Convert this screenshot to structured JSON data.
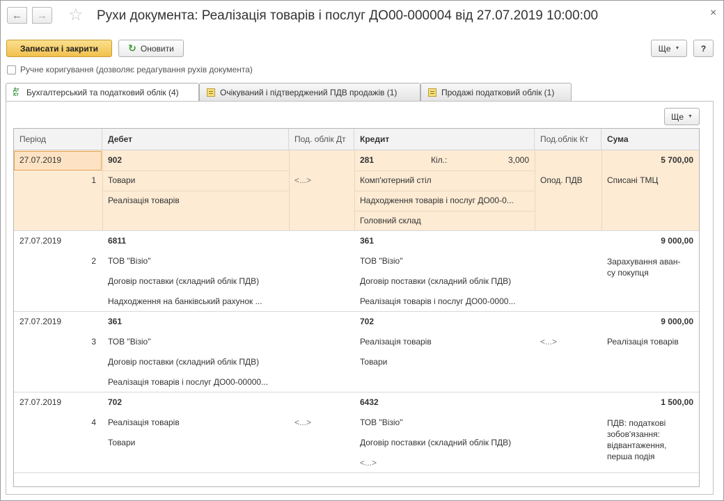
{
  "window": {
    "title": "Рухи документа: Реалізація товарів і послуг ДО00-000004 від 27.07.2019 10:00:00",
    "back_icon": "←",
    "forward_icon": "→",
    "star_icon": "☆",
    "close_icon": "×"
  },
  "toolbar": {
    "save_close_label": "Записати і закрити",
    "refresh_label": "Оновити",
    "refresh_icon": "↻",
    "more_label": "Ще",
    "help_label": "?"
  },
  "manual_edit": {
    "label": "Ручне коригування (дозволяє редагування рухів документа)",
    "checked": false
  },
  "tabs": [
    {
      "label": "Бухгалтерський та податковий облік (4)",
      "icon": "dt-kt-icon",
      "active": true
    },
    {
      "label": "Очікуваний і підтверджений ПДВ продажів (1)",
      "icon": "register-icon",
      "active": false
    },
    {
      "label": "Продажі податковий облік (1)",
      "icon": "register-icon",
      "active": false
    }
  ],
  "grid": {
    "more_label": "Ще",
    "columns": {
      "period": "Період",
      "debit": "Дебет",
      "tax_dt": "Под. облік Дт",
      "credit": "Кредит",
      "tax_kt": "Под.облік Кт",
      "sum": "Сума"
    },
    "rows": [
      {
        "period": "27.07.2019",
        "number": "1",
        "debit_account": "902",
        "debit_sub": [
          "Товари",
          "Реалізація товарів"
        ],
        "tax_dt": "<...>",
        "credit_account": "281",
        "qty_label": "Кіл.:",
        "qty_value": "3,000",
        "credit_sub": [
          "Комп'ютерний стіл",
          "Надходження товарів і послуг ДО00-0...",
          "Головний склад"
        ],
        "tax_kt": "Опод. ПДВ",
        "sum": "5 700,00",
        "content": "Списані ТМЦ"
      },
      {
        "period": "27.07.2019",
        "number": "2",
        "debit_account": "6811",
        "debit_sub": [
          "ТОВ \"Візіо\"",
          "Договір поставки (складний облік ПДВ)",
          "Надходження на банківський рахунок ..."
        ],
        "tax_dt": "",
        "credit_account": "361",
        "credit_sub": [
          "ТОВ \"Візіо\"",
          "Договір поставки (складний облік ПДВ)",
          "Реалізація товарів і послуг ДО00-0000..."
        ],
        "tax_kt": "",
        "sum": "9 000,00",
        "content": "Зарахування аван­су покупця"
      },
      {
        "period": "27.07.2019",
        "number": "3",
        "debit_account": "361",
        "debit_sub": [
          "ТОВ \"Візіо\"",
          "Договір поставки (складний облік ПДВ)",
          "Реалізація товарів і послуг ДО00-00000..."
        ],
        "tax_dt": "",
        "credit_account": "702",
        "credit_sub": [
          "Реалізація товарів",
          "Товари"
        ],
        "tax_kt": "<...>",
        "sum": "9 000,00",
        "content": "Реалізація товарів"
      },
      {
        "period": "27.07.2019",
        "number": "4",
        "debit_account": "702",
        "debit_sub": [
          "Реалізація товарів",
          "Товари"
        ],
        "tax_dt": "<...>",
        "credit_account": "6432",
        "credit_sub": [
          "ТОВ \"Візіо\"",
          "Договір поставки (складний облік ПДВ)",
          "<...>"
        ],
        "tax_kt": "",
        "sum": "1 500,00",
        "content": "ПДВ: податкові зобов'язання: відвантаження, перша подія"
      }
    ]
  }
}
